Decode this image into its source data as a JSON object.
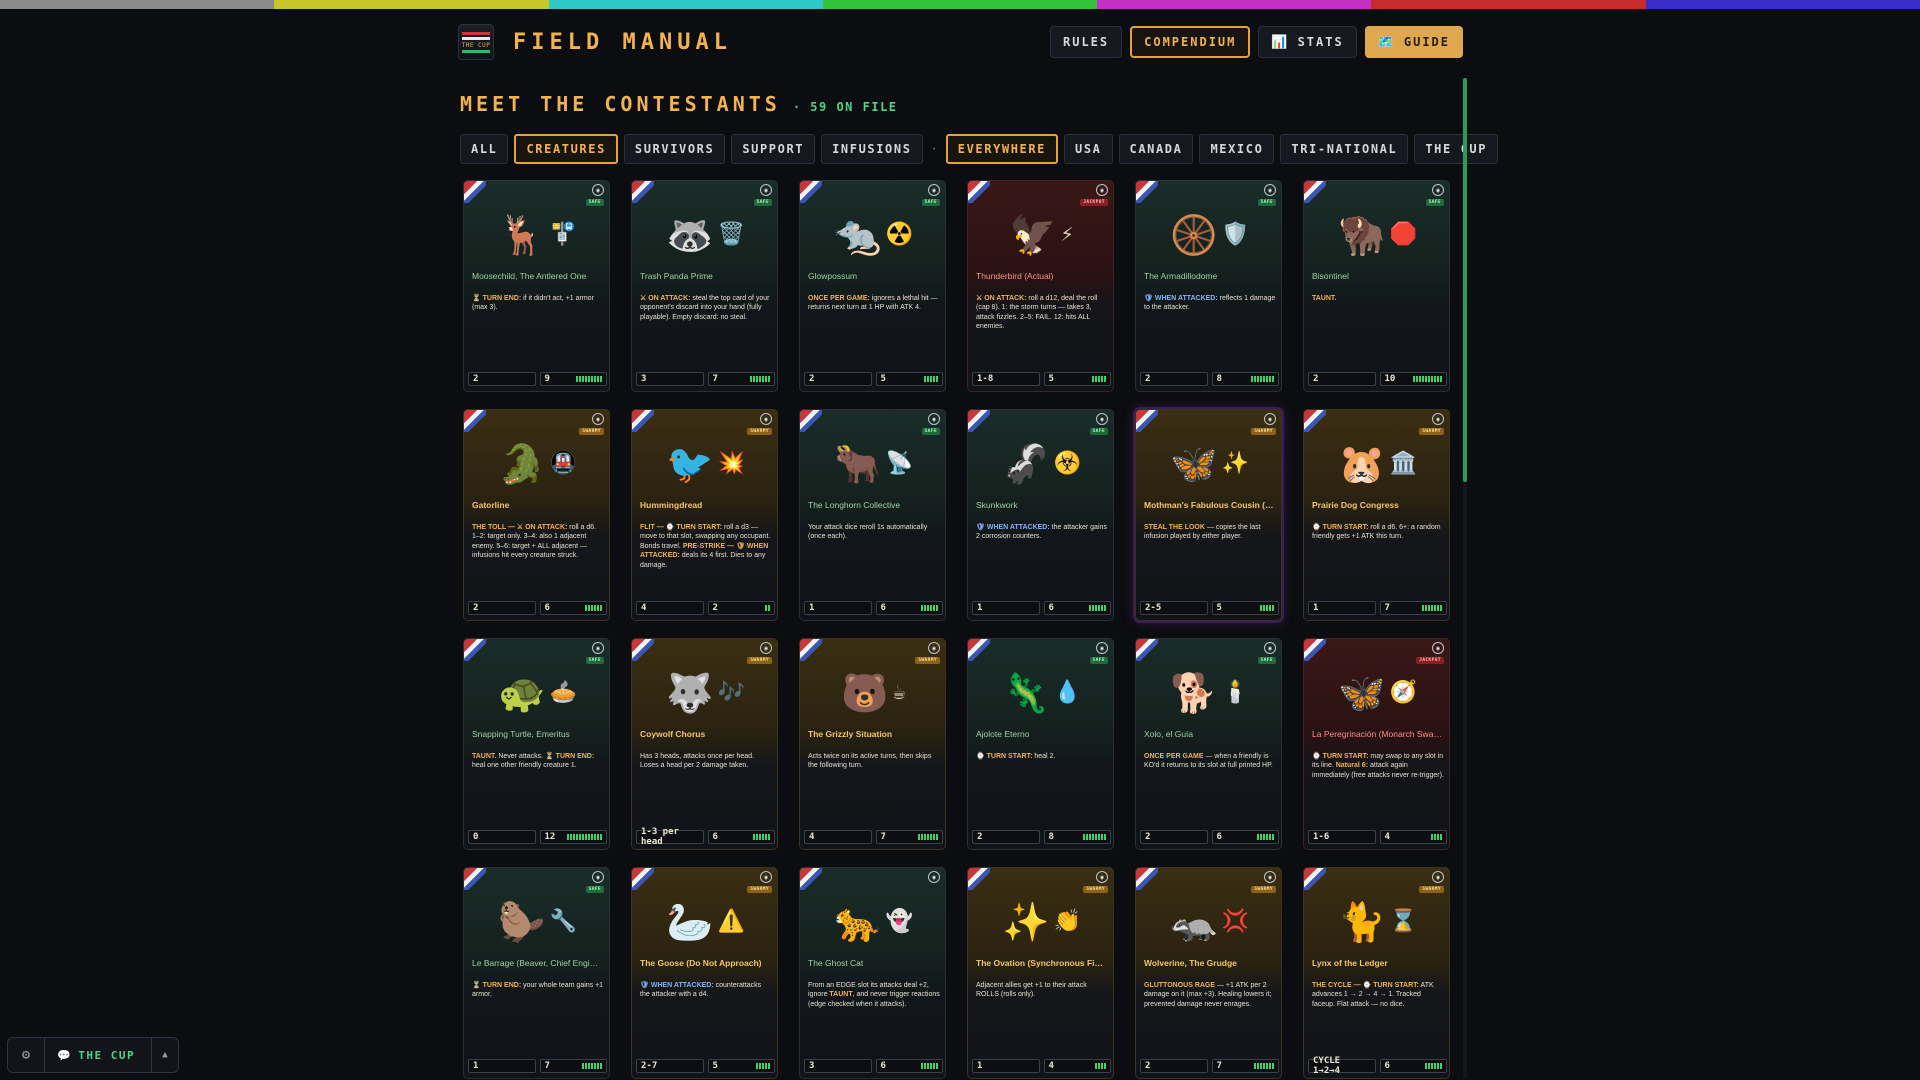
{
  "colors": {
    "rainbow": [
      "#8a8a8a",
      "#c7c72c",
      "#2fc7c7",
      "#33c23a",
      "#c42fc4",
      "#c72c2c",
      "#3a2cc7"
    ],
    "accent": "#f2b24e",
    "green": "#4bd38a"
  },
  "logo": {
    "text": "THE CUP"
  },
  "header": {
    "title": "FIELD MANUAL",
    "nav": [
      {
        "label": "RULES",
        "icon": ""
      },
      {
        "label": "COMPENDIUM",
        "icon": ""
      },
      {
        "label": "STATS",
        "icon": "📊"
      },
      {
        "label": "GUIDE",
        "icon": "🗺️"
      }
    ]
  },
  "section": {
    "title": "MEET THE CONTESTANTS",
    "count": "· 59 ON FILE"
  },
  "filters": {
    "type": [
      "ALL",
      "CREATURES",
      "SURVIVORS",
      "SUPPORT",
      "INFUSIONS"
    ],
    "separator": "·",
    "region": [
      "EVERYWHERE",
      "USA",
      "CANADA",
      "MEXICO",
      "TRI-NATIONAL",
      "THE CUP"
    ]
  },
  "cards": [
    {
      "name": "Moosechild, The Antlered One",
      "status": "SAFE",
      "tone": "green",
      "icons": [
        "🦌",
        "🚏"
      ],
      "ability": [
        [
          "kw",
          "⏳ TURN END:"
        ],
        [
          "",
          " if it didn't act, +1 armor (max 3)."
        ]
      ],
      "atk": "2",
      "hp": "9"
    },
    {
      "name": "Trash Panda Prime",
      "status": "SAFE",
      "tone": "green",
      "icons": [
        "🦝",
        "🗑️"
      ],
      "ability": [
        [
          "kw",
          "⚔ ON ATTACK:"
        ],
        [
          "",
          " steal the top card of your opponent's discard into your hand (fully playable). Empty discard: no steal."
        ]
      ],
      "atk": "3",
      "hp": "7"
    },
    {
      "name": "Glowpossum",
      "status": "SAFE",
      "tone": "green",
      "icons": [
        "🐀",
        "☢️"
      ],
      "ability": [
        [
          "kw",
          "ONCE PER GAME:"
        ],
        [
          "",
          " ignores a lethal hit — returns next turn at 1 HP with ATK 4."
        ]
      ],
      "atk": "2",
      "hp": "5"
    },
    {
      "name": "Thunderbird (Actual)",
      "status": "JACKPOT",
      "tone": "red",
      "icons": [
        "🦅",
        "⚡"
      ],
      "ability": [
        [
          "kw",
          "⚔ ON ATTACK:"
        ],
        [
          "",
          " roll a d12, deal the roll (cap 8). 1: the storm turns — takes 3, attack fizzles. 2–5: FAIL. 12: hits ALL enemies."
        ]
      ],
      "atk": "1-8",
      "hp": "5"
    },
    {
      "name": "The Armadillodome",
      "status": "SAFE",
      "tone": "green",
      "icons": [
        "🛞",
        "🛡️"
      ],
      "ability": [
        [
          "kw blue",
          "🛡 WHEN ATTACKED:"
        ],
        [
          "",
          " reflects 1 damage to the attacker."
        ]
      ],
      "atk": "2",
      "hp": "8"
    },
    {
      "name": "Bisontinel",
      "status": "SAFE",
      "tone": "green",
      "icons": [
        "🦬",
        "🛑"
      ],
      "ability": [
        [
          "kw",
          "TAUNT."
        ]
      ],
      "atk": "2",
      "hp": "10"
    },
    {
      "name": "Gatorline",
      "status": "SWARMY",
      "tone": "amber",
      "icons": [
        "🐊",
        "🚇"
      ],
      "ability": [
        [
          "kw",
          "THE TOLL — ⚔ ON ATTACK:"
        ],
        [
          "",
          " roll a d6. 1–2: target only. 3–4: also 1 adjacent enemy. 5–6: target + ALL adjacent — infusions hit every creature struck."
        ]
      ],
      "atk": "2",
      "hp": "6"
    },
    {
      "name": "Hummingdread",
      "status": "SWARMY",
      "tone": "amber",
      "icons": [
        "🐦",
        "💥"
      ],
      "ability": [
        [
          "kw",
          "FLIT — ⌚ TURN START:"
        ],
        [
          "",
          " roll a d3 — move to that slot, swapping any occupant. Bonds travel. "
        ],
        [
          "kw",
          "PRE-STRIKE — 🛡 WHEN ATTACKED:"
        ],
        [
          "",
          " deals its 4 first. Dies to any damage."
        ]
      ],
      "atk": "4",
      "hp": "2"
    },
    {
      "name": "The Longhorn Collective",
      "status": "SAFE",
      "tone": "green",
      "icons": [
        "🐂",
        "📡"
      ],
      "ability": [
        [
          "",
          "Your attack dice reroll 1s automatically (once each)."
        ]
      ],
      "atk": "1",
      "hp": "6"
    },
    {
      "name": "Skunkwork",
      "status": "SAFE",
      "tone": "green",
      "icons": [
        "🦨",
        "☣️"
      ],
      "ability": [
        [
          "kw blue",
          "🛡 WHEN ATTACKED:"
        ],
        [
          "",
          " the attacker gains 2 corrosion counters."
        ]
      ],
      "atk": "1",
      "hp": "6"
    },
    {
      "name": "Mothman's Fabulous Cousin (No Relation)",
      "status": "SWARMY",
      "tone": "amber violet",
      "icons": [
        "🦋",
        "✨"
      ],
      "ability": [
        [
          "kw",
          "STEAL THE LOOK"
        ],
        [
          "",
          " — copies the last infusion played by either player."
        ]
      ],
      "atk": "2-5",
      "hp": "5"
    },
    {
      "name": "Prairie Dog Congress",
      "status": "SWARMY",
      "tone": "amber",
      "icons": [
        "🐹",
        "🏛️"
      ],
      "ability": [
        [
          "kw",
          "⌚ TURN START:"
        ],
        [
          "",
          " roll a d6. 6+: a random friendly gets +1 ATK this turn."
        ]
      ],
      "atk": "1",
      "hp": "7"
    },
    {
      "name": "Snapping Turtle, Emeritus",
      "status": "SAFE",
      "tone": "green",
      "icons": [
        "🐢",
        "🥧"
      ],
      "ability": [
        [
          "kw",
          "TAUNT."
        ],
        [
          "",
          " Never attacks. "
        ],
        [
          "kw",
          "⏳ TURN END:"
        ],
        [
          "",
          " heal one other friendly creature 1."
        ]
      ],
      "atk": "0",
      "hp": "12"
    },
    {
      "name": "Coywolf Chorus",
      "status": "SWARMY",
      "tone": "amber",
      "icons": [
        "🐺",
        "🎶"
      ],
      "ability": [
        [
          "",
          "Has 3 heads, attacks once per head. Loses a head per 2 damage taken."
        ]
      ],
      "atk": "1-3 per head",
      "hp": "6"
    },
    {
      "name": "The Grizzly Situation",
      "status": "SWARMY",
      "tone": "amber",
      "icons": [
        "🐻",
        "☕"
      ],
      "ability": [
        [
          "",
          "Acts twice on its active turns, then skips the following turn."
        ]
      ],
      "atk": "4",
      "hp": "7"
    },
    {
      "name": "Ajolote Eterno",
      "status": "SAFE",
      "tone": "green",
      "icons": [
        "🦎",
        "💧"
      ],
      "ability": [
        [
          "kw",
          "⌚ TURN START:"
        ],
        [
          "",
          " heal 2."
        ]
      ],
      "atk": "2",
      "hp": "8"
    },
    {
      "name": "Xolo, el Guía",
      "status": "SAFE",
      "tone": "green",
      "icons": [
        "🐕",
        "🕯️"
      ],
      "ability": [
        [
          "kw",
          "ONCE PER GAME"
        ],
        [
          "",
          " — when a friendly is KO'd it returns to its slot at full printed HP."
        ]
      ],
      "atk": "2",
      "hp": "6"
    },
    {
      "name": "La Peregrinación (Monarch Swarm)",
      "status": "JACKPOT",
      "tone": "red",
      "icons": [
        "🦋",
        "🧭"
      ],
      "ability": [
        [
          "kw",
          "⌚ TURN START:"
        ],
        [
          "",
          " may swap to any slot in its line. "
        ],
        [
          "kw",
          "Natural 6:"
        ],
        [
          "",
          " attack again immediately (free attacks never re-trigger)."
        ]
      ],
      "atk": "1-6",
      "hp": "4"
    },
    {
      "name": "Le Barrage (Beaver, Chief Engineer)",
      "status": "SAFE",
      "tone": "green",
      "icons": [
        "🦫",
        "🔧"
      ],
      "ability": [
        [
          "kw",
          "⏳ TURN END:"
        ],
        [
          "",
          " your whole team gains +1 armor."
        ]
      ],
      "atk": "1",
      "hp": "7"
    },
    {
      "name": "The Goose (Do Not Approach)",
      "status": "SWARMY",
      "tone": "amber",
      "icons": [
        "🦢",
        "⚠️"
      ],
      "ability": [
        [
          "kw blue",
          "🛡 WHEN ATTACKED:"
        ],
        [
          "",
          " counterattacks the attacker with a d4."
        ]
      ],
      "atk": "2-7",
      "hp": "5"
    },
    {
      "name": "The Ghost Cat",
      "status": "",
      "tone": "green",
      "icons": [
        "🐆",
        "👻"
      ],
      "ability": [
        [
          "",
          "From an EDGE slot its attacks deal +2, ignore "
        ],
        [
          "kw",
          "TAUNT"
        ],
        [
          "",
          ", and never trigger reactions (edge checked when it attacks)."
        ]
      ],
      "atk": "3",
      "hp": "6"
    },
    {
      "name": "The Ovation (Synchronous Fireflies)",
      "status": "SWARMY",
      "tone": "amber",
      "icons": [
        "✨",
        "👏"
      ],
      "ability": [
        [
          "",
          "Adjacent allies get +1 to their attack ROLLS (rolls only)."
        ]
      ],
      "atk": "1",
      "hp": "4"
    },
    {
      "name": "Wolverine, The Grudge",
      "status": "SWARMY",
      "tone": "amber",
      "icons": [
        "🦡",
        "💢"
      ],
      "ability": [
        [
          "kw",
          "GLUTTONOUS RAGE"
        ],
        [
          "",
          " — +1 ATK per 2 damage on it (max +3). Healing lowers it; prevented damage never enrages."
        ]
      ],
      "atk": "2",
      "hp": "7"
    },
    {
      "name": "Lynx of the Ledger",
      "status": "SWARMY",
      "tone": "amber",
      "icons": [
        "🐈",
        "⌛"
      ],
      "ability": [
        [
          "kw",
          "THE CYCLE — ⌚ TURN START:"
        ],
        [
          "",
          " ATK advances 1 → 2 → 4 → 1. Tracked faceup. Flat attack — no dice."
        ]
      ],
      "atk": "CYCLE 1→2→4",
      "hp": "6"
    }
  ],
  "dock": {
    "label": "THE CUP"
  }
}
